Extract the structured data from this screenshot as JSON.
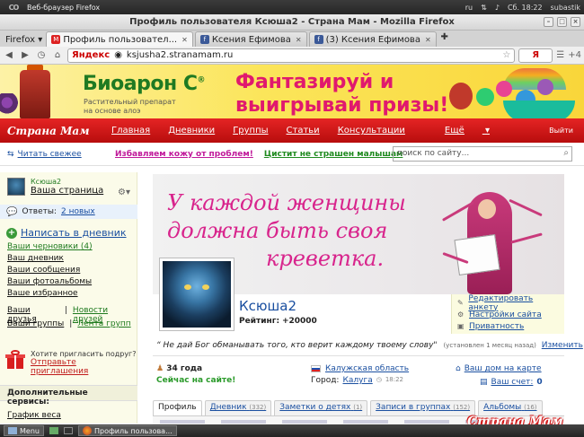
{
  "system": {
    "app_title": "Веб-браузер Firefox",
    "lang": "ru",
    "datetime": "Сб. 18:22",
    "user": "subastik"
  },
  "window": {
    "title": "Профиль пользователя Ксюша2 - Страна Мам - Mozilla Firefox"
  },
  "browser": {
    "menu_label": "Firefox",
    "tabs": [
      {
        "label": "Профиль пользовател...",
        "icon": "stranamam-favicon",
        "active": true
      },
      {
        "label": "Ксения Ефимова",
        "icon": "facebook-favicon",
        "active": false
      },
      {
        "label": "(3) Ксения Ефимова",
        "icon": "facebook-favicon",
        "active": false
      }
    ],
    "url_brand": "Яндекс",
    "url": "ksjusha2.stranamam.ru",
    "addons_count": "+4"
  },
  "banner": {
    "brand": "Биоарон С",
    "brand_mark": "®",
    "subtitle": "Растительный препарат на основе алоэ",
    "slogan_line1": "Фантазируй и",
    "slogan_line2": "выигрывай призы!"
  },
  "site": {
    "logo": "Страна Мам",
    "menu": [
      "Главная",
      "Дневники",
      "Группы",
      "Статьи",
      "Консультации",
      "Ещё"
    ],
    "logout": "Выйти",
    "read_fresh": "Читать свежее",
    "promo1": "Избавляем кожу от проблем!",
    "promo2": "Цистит не страшен малышам",
    "search_placeholder": "поиск по сайту..."
  },
  "sidebar": {
    "nick": "Ксюша2",
    "my_page": "Ваша страница",
    "answers_label": "Ответы:",
    "answers_value": "2 новых",
    "write_diary": "Написать в дневник",
    "drafts": "Ваши черновики",
    "drafts_count": "(4)",
    "links": [
      "Ваш дневник",
      "Ваши сообщения",
      "Ваши фотоальбомы",
      "Ваше избранное"
    ],
    "friends": "Ваши друзья",
    "friends_news": "Новости друзей",
    "groups": "Ваши группы",
    "groups_feed": "Лента групп",
    "invite_question": "Хотите пригласить подруг?",
    "invite_send": "Отправьте приглашения",
    "extra_services": "Дополнительные сервисы:",
    "weight_chart": "График веса"
  },
  "profile": {
    "cover_quote": [
      "У каждой женщины",
      "должна быть своя",
      "креветка."
    ],
    "name": "Ксюша2",
    "rating_label": "Рейтинг:",
    "rating_value": "+20000",
    "actions": [
      "Редактировать анкету",
      "Настройки сайта",
      "Приватность"
    ],
    "status": "Не дай Бог обманывать того, кто верит каждому твоему слову\"",
    "status_meta": "(установлен 1 месяц назад)",
    "status_edit": "Изменить",
    "age": "34 года",
    "online": "Сейчас на сайте!",
    "region": "Калужская область",
    "city_label": "Город:",
    "city": "Калуга",
    "city_time": "18:22",
    "house": "Ваш дом на карте",
    "account_label": "Ваш счет:",
    "account_value": "0",
    "tabs": [
      {
        "label": "Профиль",
        "count": ""
      },
      {
        "label": "Дневник",
        "count": "(332)"
      },
      {
        "label": "Заметки о детях",
        "count": "(1)"
      },
      {
        "label": "Записи в группах",
        "count": "(152)"
      },
      {
        "label": "Альбомы",
        "count": "(16)"
      }
    ]
  },
  "watermark": "Страна Мам",
  "taskbar": {
    "menu": "Menu",
    "window": "Профиль пользова..."
  }
}
